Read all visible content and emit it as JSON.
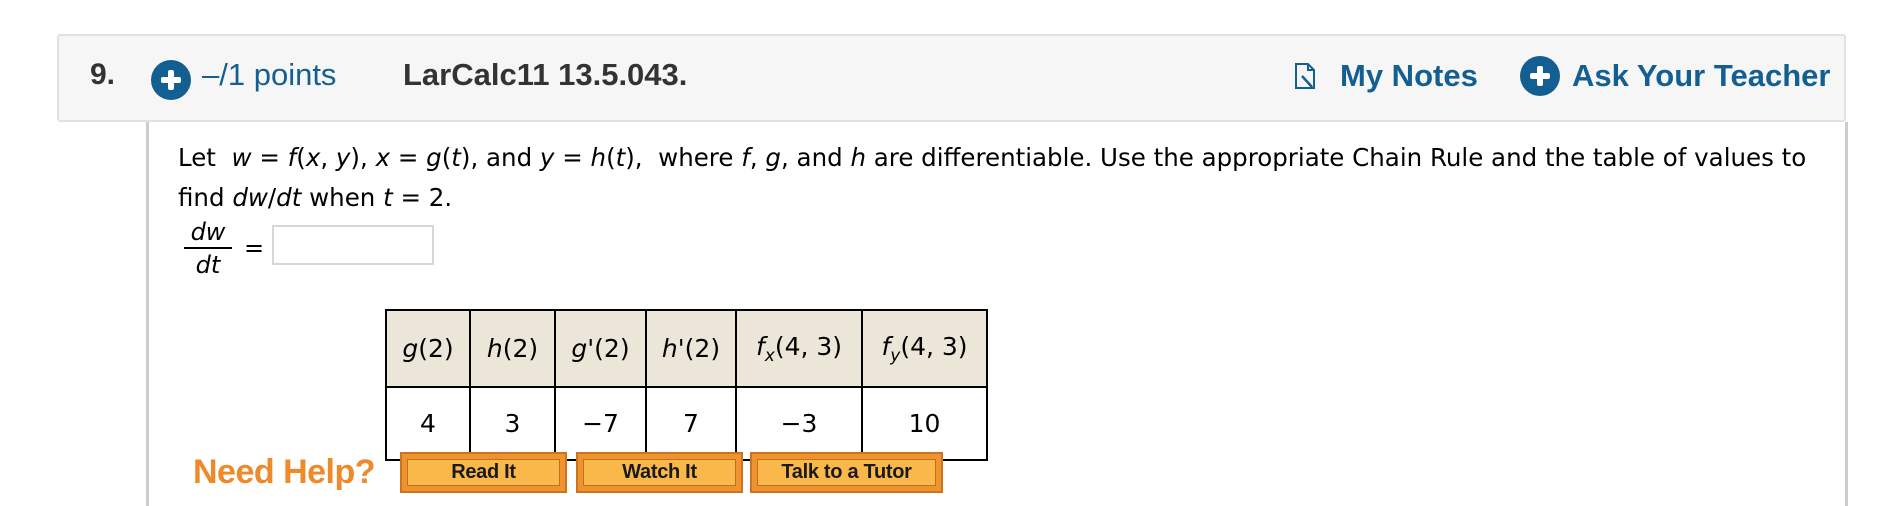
{
  "header": {
    "question_number": "9.",
    "points": "–/1 points",
    "reference": "LarCalc11 13.5.043.",
    "my_notes_label": "My Notes",
    "ask_teacher_label": "Ask Your Teacher",
    "icons": {
      "points": "plus-circle-icon",
      "notes": "notes-icon",
      "ask": "plus-circle-icon"
    },
    "accent_color": "#135f91"
  },
  "question": {
    "segments": [
      {
        "t": "Let  ",
        "i": false
      },
      {
        "t": "w",
        "i": true
      },
      {
        "t": " = ",
        "i": false
      },
      {
        "t": "f",
        "i": true
      },
      {
        "t": "(",
        "i": false
      },
      {
        "t": "x",
        "i": true
      },
      {
        "t": ", ",
        "i": false
      },
      {
        "t": "y",
        "i": true
      },
      {
        "t": "), ",
        "i": false
      },
      {
        "t": "x",
        "i": true
      },
      {
        "t": " = ",
        "i": false
      },
      {
        "t": "g",
        "i": true
      },
      {
        "t": "(",
        "i": false
      },
      {
        "t": "t",
        "i": true
      },
      {
        "t": "), and ",
        "i": false
      },
      {
        "t": "y",
        "i": true
      },
      {
        "t": " = ",
        "i": false
      },
      {
        "t": "h",
        "i": true
      },
      {
        "t": "(",
        "i": false
      },
      {
        "t": "t",
        "i": true
      },
      {
        "t": "),  where ",
        "i": false
      },
      {
        "t": "f",
        "i": true
      },
      {
        "t": ", ",
        "i": false
      },
      {
        "t": "g",
        "i": true
      },
      {
        "t": ", and ",
        "i": false
      },
      {
        "t": "h",
        "i": true
      },
      {
        "t": " are differentiable. Use the appropriate Chain Rule and the table of values to find ",
        "i": false
      },
      {
        "t": "dw",
        "i": true
      },
      {
        "t": "/",
        "i": false
      },
      {
        "t": "dt",
        "i": true
      },
      {
        "t": " when ",
        "i": false
      },
      {
        "t": "t",
        "i": true
      },
      {
        "t": " = 2.",
        "i": false
      }
    ]
  },
  "answer": {
    "numerator": "dw",
    "denominator": "dt",
    "equals": "=",
    "value": "",
    "placeholder": ""
  },
  "table": {
    "headers": [
      {
        "fn": "g",
        "sub": "",
        "prime": "",
        "args": "(2)"
      },
      {
        "fn": "h",
        "sub": "",
        "prime": "",
        "args": "(2)"
      },
      {
        "fn": "g",
        "sub": "",
        "prime": "'",
        "args": "(2)"
      },
      {
        "fn": "h",
        "sub": "",
        "prime": "'",
        "args": "(2)"
      },
      {
        "fn": "f",
        "sub": "x",
        "prime": "",
        "args": "(4, 3)"
      },
      {
        "fn": "f",
        "sub": "y",
        "prime": "",
        "args": "(4, 3)"
      }
    ],
    "values": [
      "4",
      "3",
      "−7",
      "7",
      "−3",
      "10"
    ]
  },
  "help": {
    "label": "Need Help?",
    "buttons": [
      "Read It",
      "Watch It",
      "Talk to a Tutor"
    ],
    "label_color": "#ee8a2a",
    "button_color": "#fbb84a"
  }
}
